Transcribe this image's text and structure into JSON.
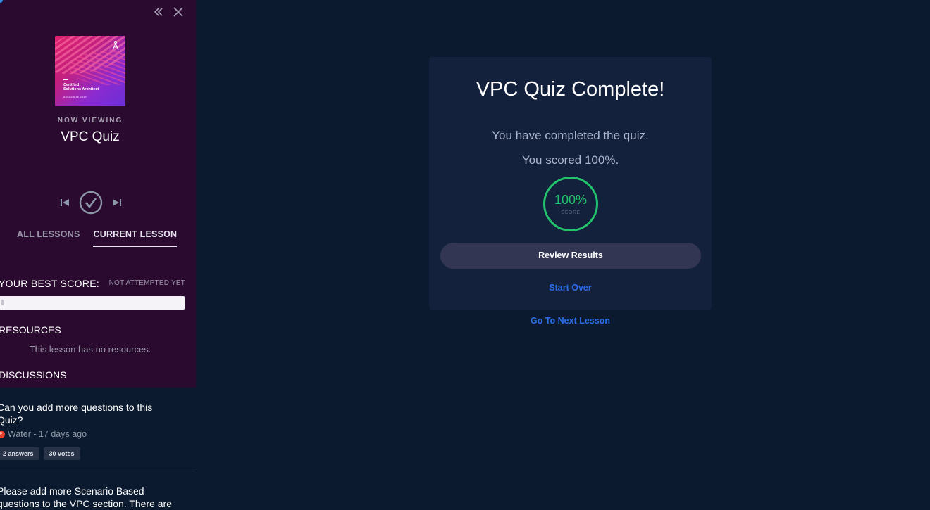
{
  "sidebar": {
    "cover": {
      "line1": "Certified",
      "line2": "Solutions Architect",
      "line3": "ASSOCIATE 2019"
    },
    "now_viewing_label": "NOW VIEWING",
    "lesson_title": "VPC Quiz",
    "tabs": [
      {
        "label": "ALL LESSONS",
        "active": false
      },
      {
        "label": "CURRENT LESSON",
        "active": true
      }
    ],
    "best_score": {
      "label": "YOUR BEST SCORE:",
      "value": "NOT ATTEMPTED YET"
    },
    "resources": {
      "label": "RESOURCES",
      "empty_text": "This lesson has no resources."
    },
    "discussions": {
      "label": "DISCUSSIONS",
      "items": [
        {
          "title": "Can you add more questions to this Quiz?",
          "author": "Water",
          "time": "17 days ago",
          "meta": "Water - 17 days ago",
          "answers": "2 answers",
          "votes": "30 votes"
        },
        {
          "title": "Please add more Scenario Based questions to the VPC section. There are"
        }
      ]
    }
  },
  "main": {
    "title": "VPC Quiz Complete!",
    "completed_text": "You have completed the quiz.",
    "scored_text": "You scored 100%.",
    "score": {
      "value": "100%",
      "label": "SCORE"
    },
    "review_button": "Review Results",
    "start_over": "Start Over",
    "next_lesson": "Go To Next Lesson"
  },
  "colors": {
    "sidebar_bg": "#2b0a30",
    "page_bg": "#0b1a2e",
    "card_bg": "#14213c",
    "accent_green": "#22c36b",
    "link_blue": "#2c6ee8"
  }
}
